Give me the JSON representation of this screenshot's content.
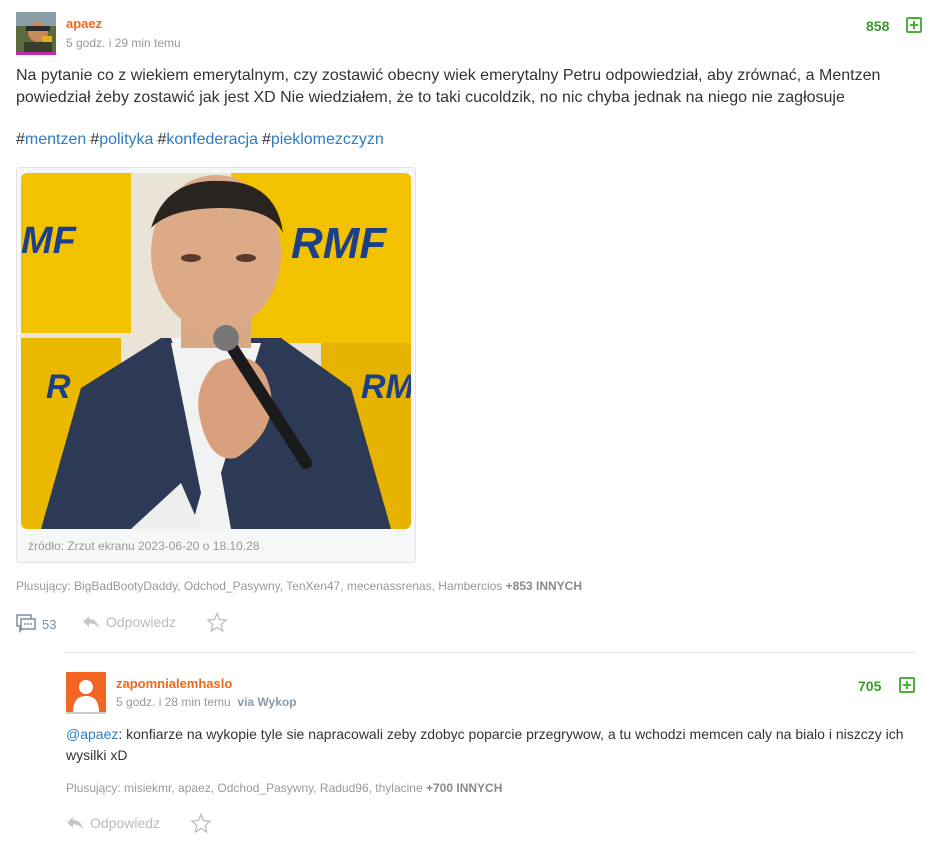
{
  "post": {
    "author": "apaez",
    "time": "5 godz. i 29 min temu",
    "score": "858",
    "text": "Na pytanie co z wiekiem emerytalnym, czy zostawić obecny wiek emerytalny Petru odpowiedział, aby zrównać, a Mentzen powiedział żeby zostawić jak jest XD Nie wiedziałem, że to taki cucoldzik, no nic chyba jednak na niego nie zagłosuje",
    "tags": [
      "mentzen",
      "polityka",
      "konfederacja",
      "pieklomezczyzn"
    ],
    "image_caption": "źródło: Zrzut ekranu 2023-06-20 o 18.10.28",
    "voters_label": "Plusujący:",
    "voters": "BigBadBootyDaddy, Odchod_Pasywny, TenXen47, mecenassrenas, Hambercios",
    "voters_more": "+853 INNYCH",
    "comments_count": "53",
    "reply_label": "Odpowiedz"
  },
  "comment": {
    "author": "zapomnialemhaslo",
    "time": "5 godz. i 28 min temu",
    "via": "via Wykop",
    "score": "705",
    "mention": "@apaez",
    "text": ": konfiarze na wykopie tyle sie napracowali zeby zdobyc poparcie przegrywow, a tu wchodzi memcen caly na bialo i niszczy ich wysilki xD",
    "voters_label": "Plusujący:",
    "voters": "misiekmr, apaez, Odchod_Pasywny, Radud96, thylacine",
    "voters_more": "+700 INNYCH",
    "reply_label": "Odpowiedz"
  },
  "colors": {
    "author": "#ea6a1f",
    "score": "#3a9a2a",
    "tag": "#2f7bbf",
    "rmf_yellow": "#f2c200"
  },
  "icons": [
    "plus-square-icon",
    "comments-icon",
    "reply-icon",
    "star-icon"
  ]
}
